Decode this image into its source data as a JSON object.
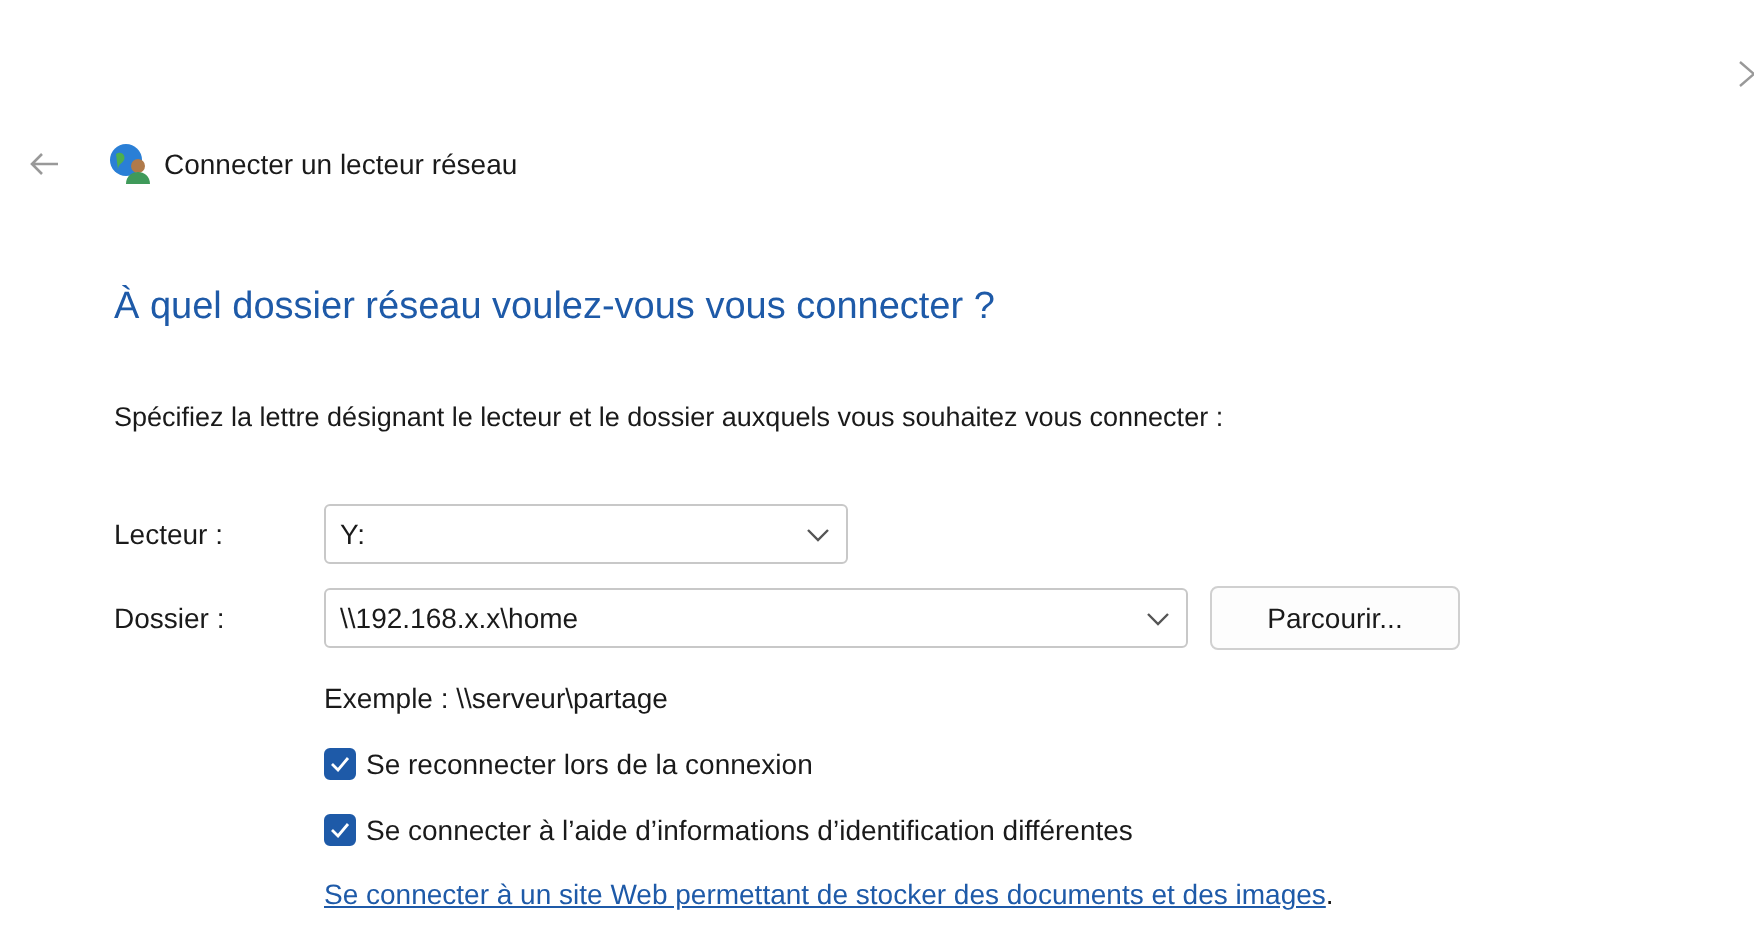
{
  "window": {
    "title": "Connecter un lecteur réseau"
  },
  "heading": "À quel dossier réseau voulez-vous vous connecter ?",
  "instruction": "Spécifiez la lettre désignant le lecteur et le dossier auxquels vous souhaitez vous connecter :",
  "drive": {
    "label": "Lecteur :",
    "value": "Y:"
  },
  "folder": {
    "label": "Dossier :",
    "value": "\\\\192.168.x.x\\home",
    "browse_button": "Parcourir..."
  },
  "example": "Exemple : \\\\serveur\\partage",
  "options": [
    {
      "label": "Se reconnecter lors de la connexion",
      "checked": true
    },
    {
      "label": "Se connecter à l’aide d’informations d’identification différentes",
      "checked": true
    }
  ],
  "link": {
    "text": "Se connecter à un site Web permettant de stocker des documents et des images",
    "suffix": "."
  }
}
